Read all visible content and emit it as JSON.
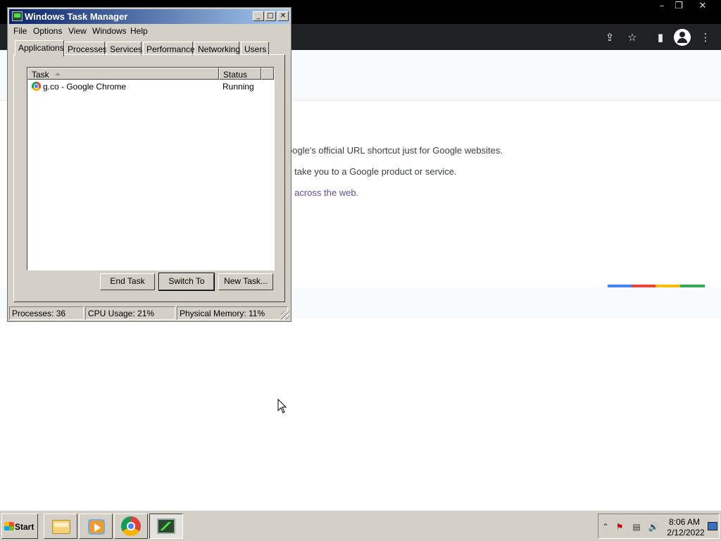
{
  "browser": {
    "window_controls": {
      "minimize": "–",
      "restore": "❐",
      "close": "✕"
    },
    "toolbar_icons": {
      "share": "⇪",
      "bookmark": "☆",
      "sidepanel": "▮",
      "menu": "⋮"
    },
    "page_lines": [
      "oogle's official URL shortcut just for Google websites.",
      "s take you to a Google product or service.",
      "s across the web."
    ],
    "brand_colors": [
      "#4285f4",
      "#ea4335",
      "#fbbc05",
      "#34a853"
    ]
  },
  "task_manager": {
    "title": "Windows Task Manager",
    "caption_buttons": {
      "minimize": "_",
      "maximize": "□",
      "close": "✕"
    },
    "menu": [
      "File",
      "Options",
      "View",
      "Windows",
      "Help"
    ],
    "tabs": [
      "Applications",
      "Processes",
      "Services",
      "Performance",
      "Networking",
      "Users"
    ],
    "active_tab": "Applications",
    "columns": [
      "Task",
      "Status"
    ],
    "tasks": [
      {
        "icon": "chrome-icon",
        "task": "g.co - Google Chrome",
        "status": "Running"
      }
    ],
    "buttons": {
      "end_task": "End Task",
      "switch_to": "Switch To",
      "new_task": "New Task..."
    },
    "status": {
      "processes": "Processes: 36",
      "cpu": "CPU Usage: 21%",
      "memory": "Physical Memory: 11%"
    }
  },
  "taskbar": {
    "start_label": "Start",
    "pinned": [
      "folder-icon",
      "media-player-icon",
      "chrome-icon",
      "task-manager-icon"
    ],
    "tray_icons": {
      "expand": "⌃",
      "flag": "⚑",
      "network": "▤",
      "volume": "🔊"
    },
    "clock": {
      "time": "8:06 AM",
      "date": "2/12/2022"
    }
  }
}
